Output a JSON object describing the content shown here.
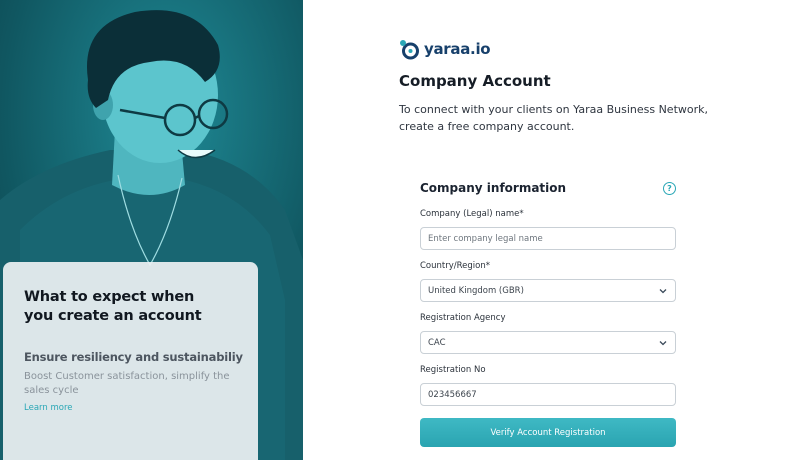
{
  "brand": {
    "logo_text": "yaraa.io",
    "accent_color": "#2aa7b6",
    "logo_color": "#17406b"
  },
  "header": {
    "title": "Company Account",
    "intro": "To connect with your clients on Yaraa Business Network, create a free company account."
  },
  "hero_card": {
    "title": "What to expect when\nyou create an account",
    "subtitle": "Ensure resiliency and sustainabiliy",
    "body": "Boost Customer satisfaction, simplify the sales cycle",
    "link": "Learn more"
  },
  "form": {
    "title": "Company information",
    "help_icon": "question-circle-icon",
    "fields": {
      "legal_name": {
        "label": "Company (Legal) name*",
        "placeholder": "Enter company legal name",
        "value": ""
      },
      "country": {
        "label": "Country/Region*",
        "value": "United Kingdom (GBR)",
        "icon": "chevron-down-icon"
      },
      "agency": {
        "label": "Registration Agency",
        "value": "CAC",
        "icon": "chevron-down-icon"
      },
      "reg_no": {
        "label": "Registration No",
        "value": "023456667"
      }
    },
    "submit_label": "Verify Account Registration"
  }
}
